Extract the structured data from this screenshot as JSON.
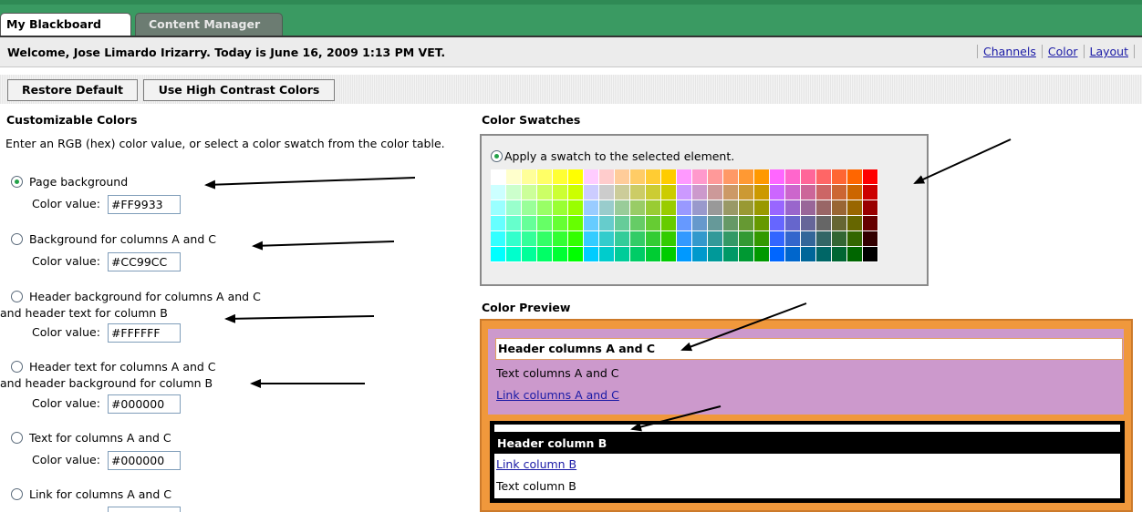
{
  "tabs": [
    {
      "label": "My Blackboard",
      "active": true
    },
    {
      "label": "Content Manager",
      "active": false
    }
  ],
  "welcome": "Welcome, Jose Limardo Irizarry. Today is June 16, 2009 1:13 PM VET.",
  "top_links": [
    "Channels",
    "Color",
    "Layout"
  ],
  "buttons": {
    "restore": "Restore Default",
    "contrast": "Use High Contrast Colors"
  },
  "left": {
    "heading": "Customizable Colors",
    "instructions": "Enter an RGB (hex) color value, or select a color swatch from the color table.",
    "color_value_label": "Color value:",
    "options": [
      {
        "label": "Page background",
        "value": "#FF9933",
        "selected": true
      },
      {
        "label": "Background for columns A and C",
        "value": "#CC99CC",
        "selected": false
      },
      {
        "label": "Header background for columns A and C",
        "label2": "and header text for column B",
        "value": "#FFFFFF",
        "selected": false
      },
      {
        "label": "Header text for columns A and C",
        "label2": "and header background for column B",
        "value": "#000000",
        "selected": false
      },
      {
        "label": "Text for columns A and C",
        "value": "#000000",
        "selected": false
      },
      {
        "label": "Link for columns A and C",
        "value": "",
        "selected": false
      }
    ]
  },
  "swatches": {
    "heading": "Color Swatches",
    "apply_label": "Apply a swatch to the selected element.",
    "colors": [
      [
        "#FFFFFF",
        "#FFFFCC",
        "#FFFF99",
        "#FFFF66",
        "#FFFF33",
        "#FFFF00",
        "#FFCCFF",
        "#FFCCCC",
        "#FFCC99",
        "#FFCC66",
        "#FFCC33",
        "#FFCC00",
        "#FF99FF",
        "#FF99CC",
        "#FF9999",
        "#FF9966",
        "#FF9933",
        "#FF9900",
        "#FF66FF",
        "#FF66CC",
        "#FF6699",
        "#FF6666",
        "#FF6633",
        "#FF6600",
        "#FF0000"
      ],
      [
        "#CCFFFF",
        "#CCFFCC",
        "#CCFF99",
        "#CCFF66",
        "#CCFF33",
        "#CCFF00",
        "#CCCCFF",
        "#CCCCCC",
        "#CCCC99",
        "#CCCC66",
        "#CCCC33",
        "#CCCC00",
        "#CC99FF",
        "#CC99CC",
        "#CC9999",
        "#CC9966",
        "#CC9933",
        "#CC9900",
        "#CC66FF",
        "#CC66CC",
        "#CC6699",
        "#CC6666",
        "#CC6633",
        "#CC6600",
        "#CC0000"
      ],
      [
        "#99FFFF",
        "#99FFCC",
        "#99FF99",
        "#99FF66",
        "#99FF33",
        "#99FF00",
        "#99CCFF",
        "#99CCCC",
        "#99CC99",
        "#99CC66",
        "#99CC33",
        "#99CC00",
        "#9999FF",
        "#9999CC",
        "#999999",
        "#999966",
        "#999933",
        "#999900",
        "#9966FF",
        "#9966CC",
        "#996699",
        "#996666",
        "#996633",
        "#996600",
        "#990000"
      ],
      [
        "#66FFFF",
        "#66FFCC",
        "#66FF99",
        "#66FF66",
        "#66FF33",
        "#66FF00",
        "#66CCFF",
        "#66CCCC",
        "#66CC99",
        "#66CC66",
        "#66CC33",
        "#66CC00",
        "#6699FF",
        "#6699CC",
        "#669999",
        "#669966",
        "#669933",
        "#669900",
        "#6666FF",
        "#6666CC",
        "#666699",
        "#666666",
        "#666633",
        "#666600",
        "#660000"
      ],
      [
        "#33FFFF",
        "#33FFCC",
        "#33FF99",
        "#33FF66",
        "#33FF33",
        "#33FF00",
        "#33CCFF",
        "#33CCCC",
        "#33CC99",
        "#33CC66",
        "#33CC33",
        "#33CC00",
        "#3399FF",
        "#3399CC",
        "#339999",
        "#339966",
        "#339933",
        "#339900",
        "#3366FF",
        "#3366CC",
        "#336699",
        "#336666",
        "#336633",
        "#336600",
        "#330000"
      ],
      [
        "#00FFFF",
        "#00FFCC",
        "#00FF99",
        "#00FF66",
        "#00FF33",
        "#00FF00",
        "#00CCFF",
        "#00CCCC",
        "#00CC99",
        "#00CC66",
        "#00CC33",
        "#00CC00",
        "#0099FF",
        "#0099CC",
        "#009999",
        "#009966",
        "#009933",
        "#009900",
        "#0066FF",
        "#0066CC",
        "#006699",
        "#006666",
        "#006633",
        "#006600",
        "#000000"
      ]
    ]
  },
  "preview": {
    "heading": "Color Preview",
    "header_ac": "Header columns A and C",
    "text_ac": "Text columns A and C",
    "link_ac": "Link columns A and C",
    "header_b": "Header column B",
    "link_b": "Link column B",
    "text_b": "Text column B"
  }
}
